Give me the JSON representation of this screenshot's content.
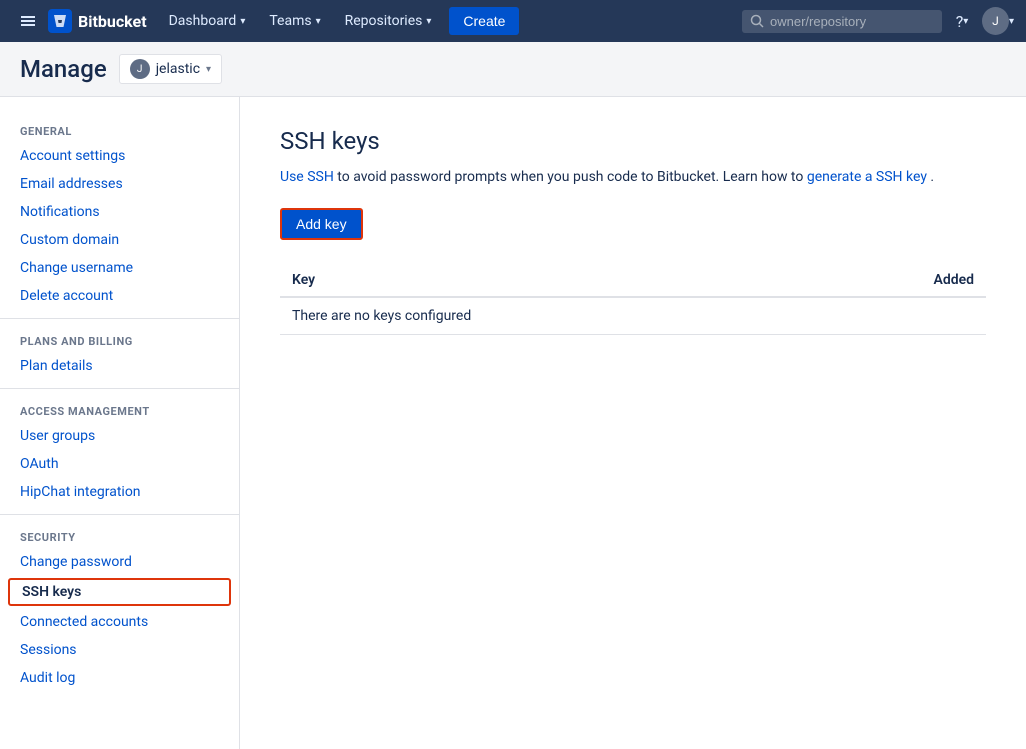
{
  "navbar": {
    "logo_text": "Bitbucket",
    "hamburger_label": "☰",
    "nav_items": [
      {
        "label": "Dashboard",
        "id": "dashboard"
      },
      {
        "label": "Teams",
        "id": "teams"
      },
      {
        "label": "Repositories",
        "id": "repositories"
      }
    ],
    "create_label": "Create",
    "search_placeholder": "owner/repository",
    "help_label": "?",
    "user_initial": "J"
  },
  "page_header": {
    "title": "Manage",
    "user_name": "jelastic",
    "user_initial": "J"
  },
  "sidebar": {
    "sections": [
      {
        "label": "General",
        "id": "general",
        "items": [
          {
            "label": "Account settings",
            "id": "account-settings",
            "active": false
          },
          {
            "label": "Email addresses",
            "id": "email-addresses",
            "active": false
          },
          {
            "label": "Notifications",
            "id": "notifications",
            "active": false
          },
          {
            "label": "Custom domain",
            "id": "custom-domain",
            "active": false
          },
          {
            "label": "Change username",
            "id": "change-username",
            "active": false
          },
          {
            "label": "Delete account",
            "id": "delete-account",
            "active": false
          }
        ]
      },
      {
        "label": "Plans and Billing",
        "id": "plans-billing",
        "items": [
          {
            "label": "Plan details",
            "id": "plan-details",
            "active": false
          }
        ]
      },
      {
        "label": "Access Management",
        "id": "access-management",
        "items": [
          {
            "label": "User groups",
            "id": "user-groups",
            "active": false
          },
          {
            "label": "OAuth",
            "id": "oauth",
            "active": false
          },
          {
            "label": "HipChat integration",
            "id": "hipchat-integration",
            "active": false
          }
        ]
      },
      {
        "label": "Security",
        "id": "security",
        "items": [
          {
            "label": "Change password",
            "id": "change-password",
            "active": false
          },
          {
            "label": "SSH keys",
            "id": "ssh-keys",
            "active": true
          },
          {
            "label": "Connected accounts",
            "id": "connected-accounts",
            "active": false
          },
          {
            "label": "Sessions",
            "id": "sessions",
            "active": false
          },
          {
            "label": "Audit log",
            "id": "audit-log",
            "active": false
          }
        ]
      }
    ]
  },
  "content": {
    "title": "SSH keys",
    "description_prefix": "Use SSH",
    "description_use_ssh_href": "#",
    "description_middle": " to avoid password prompts when you push code to Bitbucket. Learn how to ",
    "description_generate_href": "#",
    "description_generate": "generate a SSH key",
    "description_suffix": ".",
    "add_key_label": "Add key",
    "table": {
      "columns": [
        {
          "label": "Key",
          "id": "key"
        },
        {
          "label": "Added",
          "id": "added"
        }
      ],
      "empty_message": "There are no keys configured"
    }
  }
}
